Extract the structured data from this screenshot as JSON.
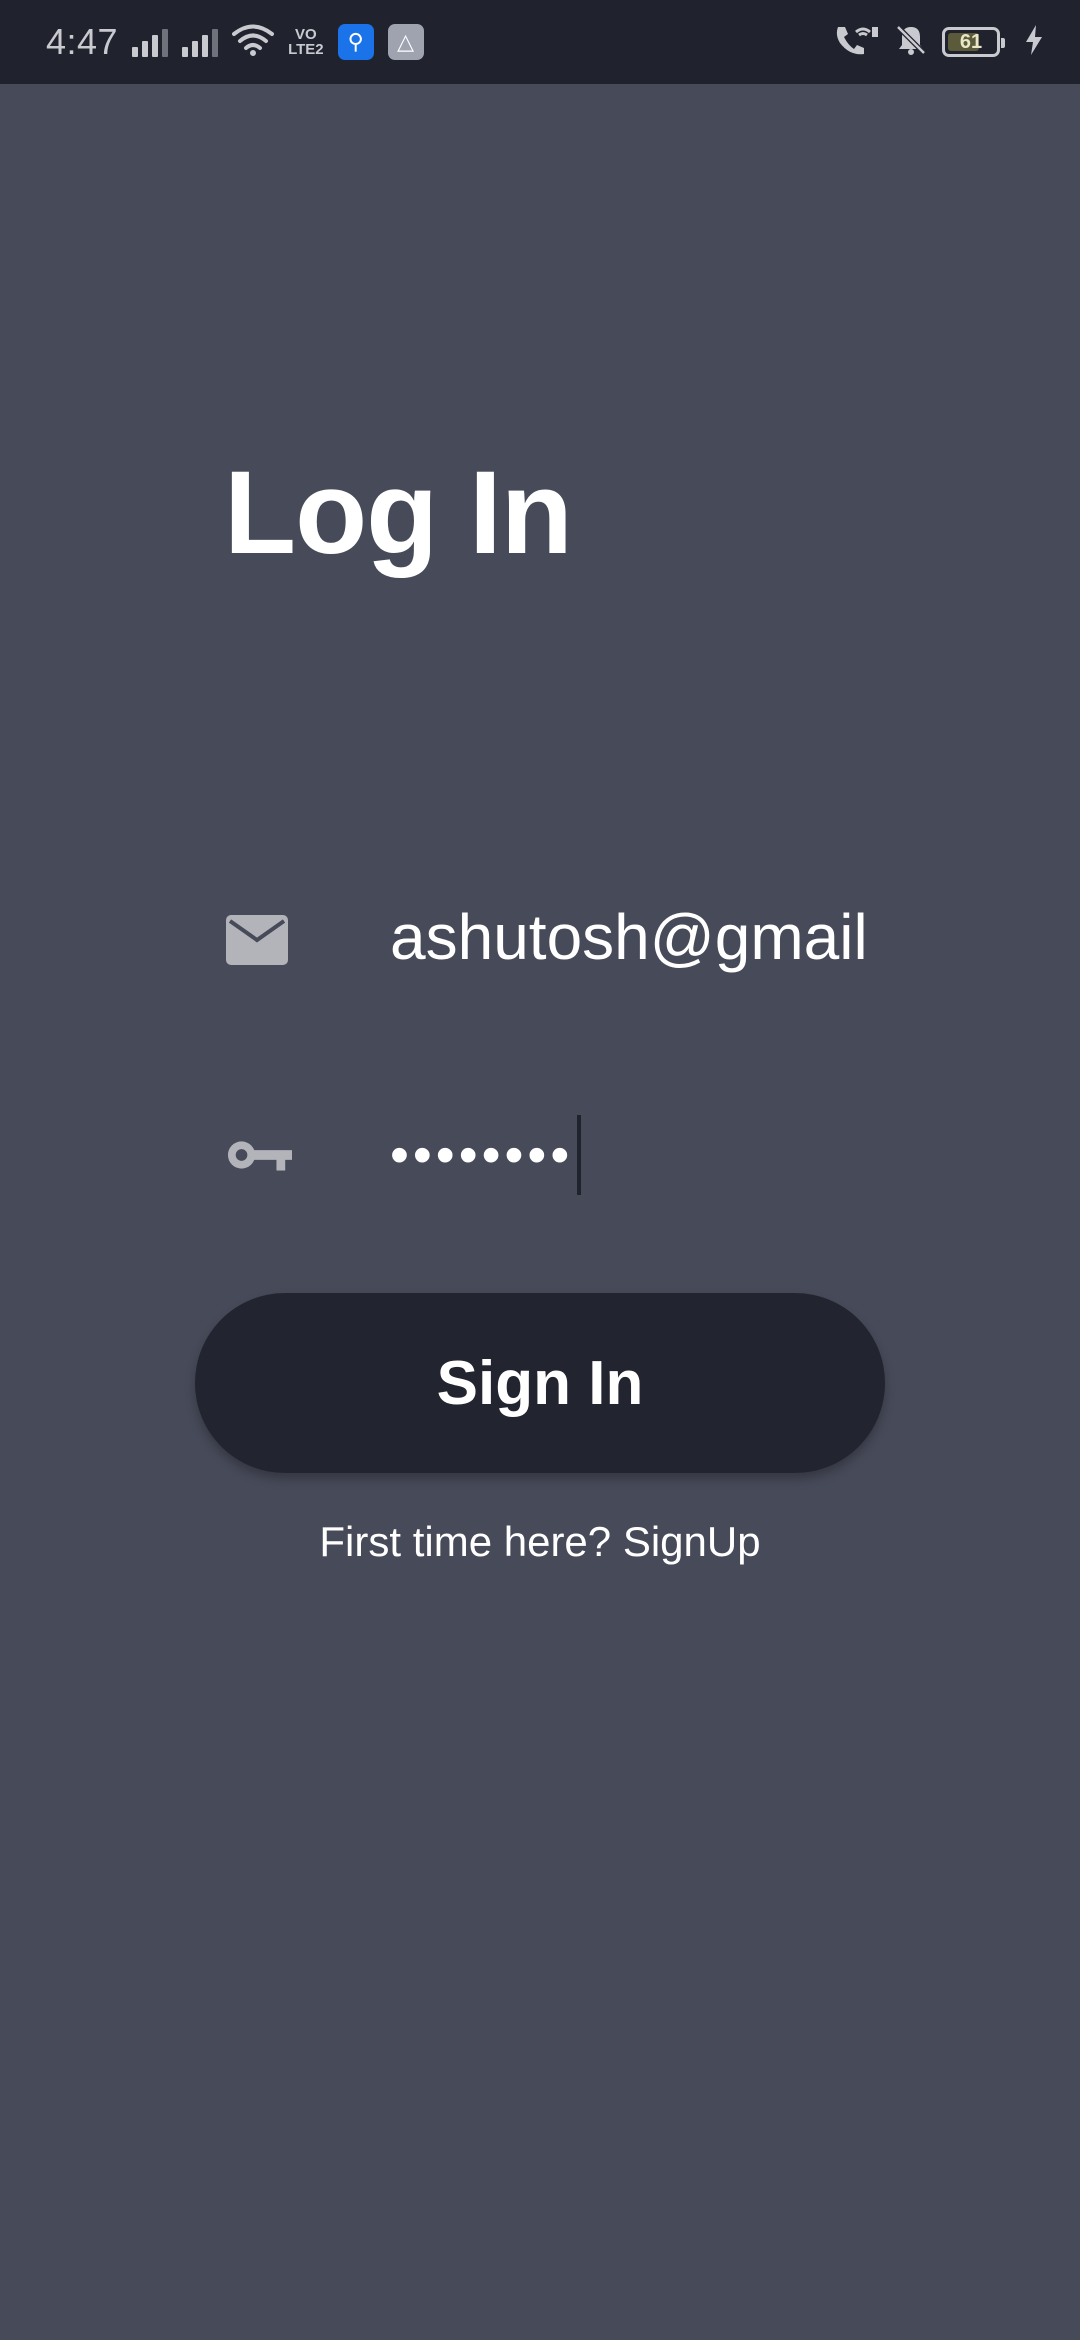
{
  "status_bar": {
    "time": "4:47",
    "volte_label": "VO\nLTE2",
    "battery_level": "61",
    "icons": [
      "signal-icon",
      "signal-icon",
      "wifi-icon",
      "volte-icon",
      "usb-icon",
      "app-icon",
      "wifi-call-icon",
      "mute-icon",
      "battery-icon",
      "charging-icon"
    ]
  },
  "login": {
    "title": "Log In",
    "email_value": "ashutosh@gmail",
    "password_mask": "••••••••",
    "sign_in_label": "Sign In",
    "signup_text": "First time here? SignUp"
  },
  "colors": {
    "background": "#474a59",
    "status_bar": "#20222d",
    "button": "#22242f",
    "icon_gray": "#b3b4ba"
  }
}
